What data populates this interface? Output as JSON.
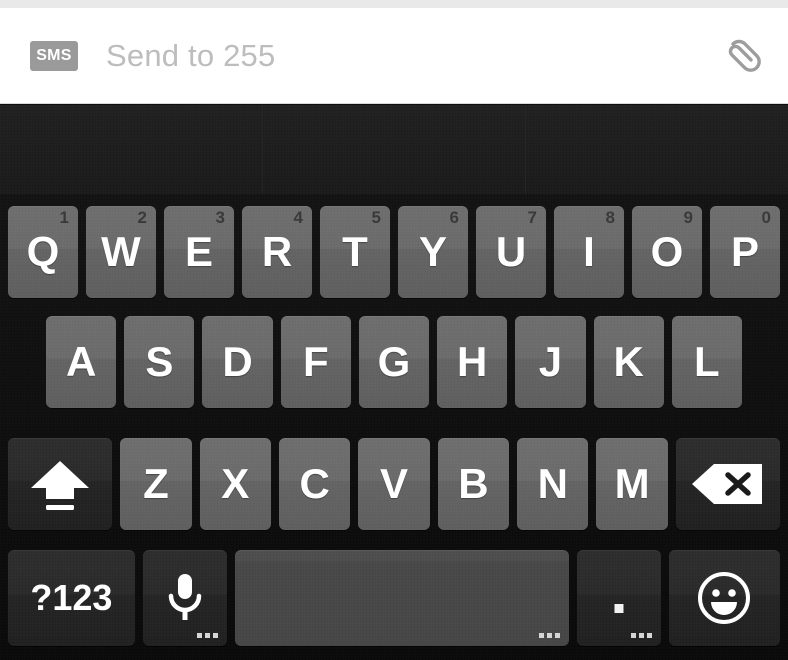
{
  "compose": {
    "badge_label": "SMS",
    "placeholder": "Send to 255",
    "input_value": "",
    "attach_icon": "paperclip-icon",
    "badge_color": "#9a9a9a",
    "placeholder_color": "#bdbdbd",
    "background_color": "#ffffff"
  },
  "suggestions": {
    "cells": [
      "",
      "",
      ""
    ]
  },
  "keyboard": {
    "theme": {
      "background": "#0d0d0d",
      "letter_key_color": "#6a6a6a",
      "function_key_color": "#2a2a2a",
      "spacebar_color": "#474747",
      "glyph_color": "#ffffff",
      "number_hint_color": "#3a3a3a"
    },
    "row1": [
      {
        "label": "Q",
        "num": "1"
      },
      {
        "label": "W",
        "num": "2"
      },
      {
        "label": "E",
        "num": "3"
      },
      {
        "label": "R",
        "num": "4"
      },
      {
        "label": "T",
        "num": "5"
      },
      {
        "label": "Y",
        "num": "6"
      },
      {
        "label": "U",
        "num": "7"
      },
      {
        "label": "I",
        "num": "8"
      },
      {
        "label": "O",
        "num": "9"
      },
      {
        "label": "P",
        "num": "0"
      }
    ],
    "row2": [
      {
        "label": "A"
      },
      {
        "label": "S"
      },
      {
        "label": "D"
      },
      {
        "label": "F"
      },
      {
        "label": "G"
      },
      {
        "label": "H"
      },
      {
        "label": "J"
      },
      {
        "label": "K"
      },
      {
        "label": "L"
      }
    ],
    "row3": {
      "shift": {
        "icon": "shift-arrow-icon",
        "label": ""
      },
      "letters": [
        {
          "label": "Z"
        },
        {
          "label": "X"
        },
        {
          "label": "C"
        },
        {
          "label": "V"
        },
        {
          "label": "B"
        },
        {
          "label": "N"
        },
        {
          "label": "M"
        }
      ],
      "backspace": {
        "icon": "backspace-icon",
        "label": ""
      }
    },
    "row4": {
      "symbols": {
        "label": "?123"
      },
      "mic": {
        "icon": "microphone-icon",
        "label": ""
      },
      "space": {
        "label": ""
      },
      "period": {
        "label": "."
      },
      "emoji": {
        "icon": "smiley-face-icon",
        "label": ""
      }
    }
  }
}
